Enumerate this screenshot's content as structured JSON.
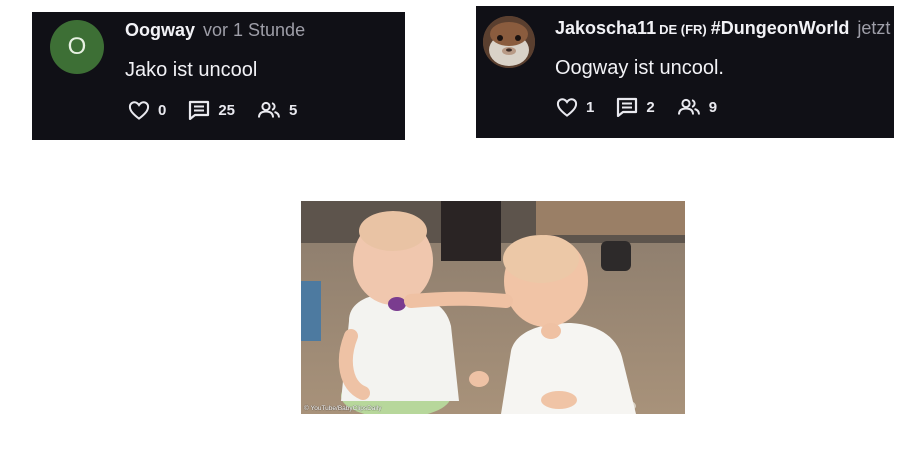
{
  "posts": [
    {
      "avatar_letter": "O",
      "username": "Oogway",
      "time": "vor 1 Stunde",
      "message": "Jako ist uncool",
      "likes": "0",
      "comments": "25",
      "participants": "5"
    },
    {
      "username": "Jakoscha11",
      "language": "DE (FR)",
      "tag": "#DungeonWorld",
      "time": "jetzt",
      "message": "Oogway ist uncool.",
      "likes": "1",
      "comments": "2",
      "participants": "9"
    }
  ],
  "image": {
    "credit": "© YouTube/BabyClipsDaily"
  },
  "colors": {
    "card_background": "#101016",
    "avatar_green": "#3d6f35",
    "text_primary": "#f2f2f6",
    "text_secondary": "#9e9ea8"
  },
  "icons": [
    "heart-icon",
    "comment-icon",
    "participants-icon"
  ]
}
